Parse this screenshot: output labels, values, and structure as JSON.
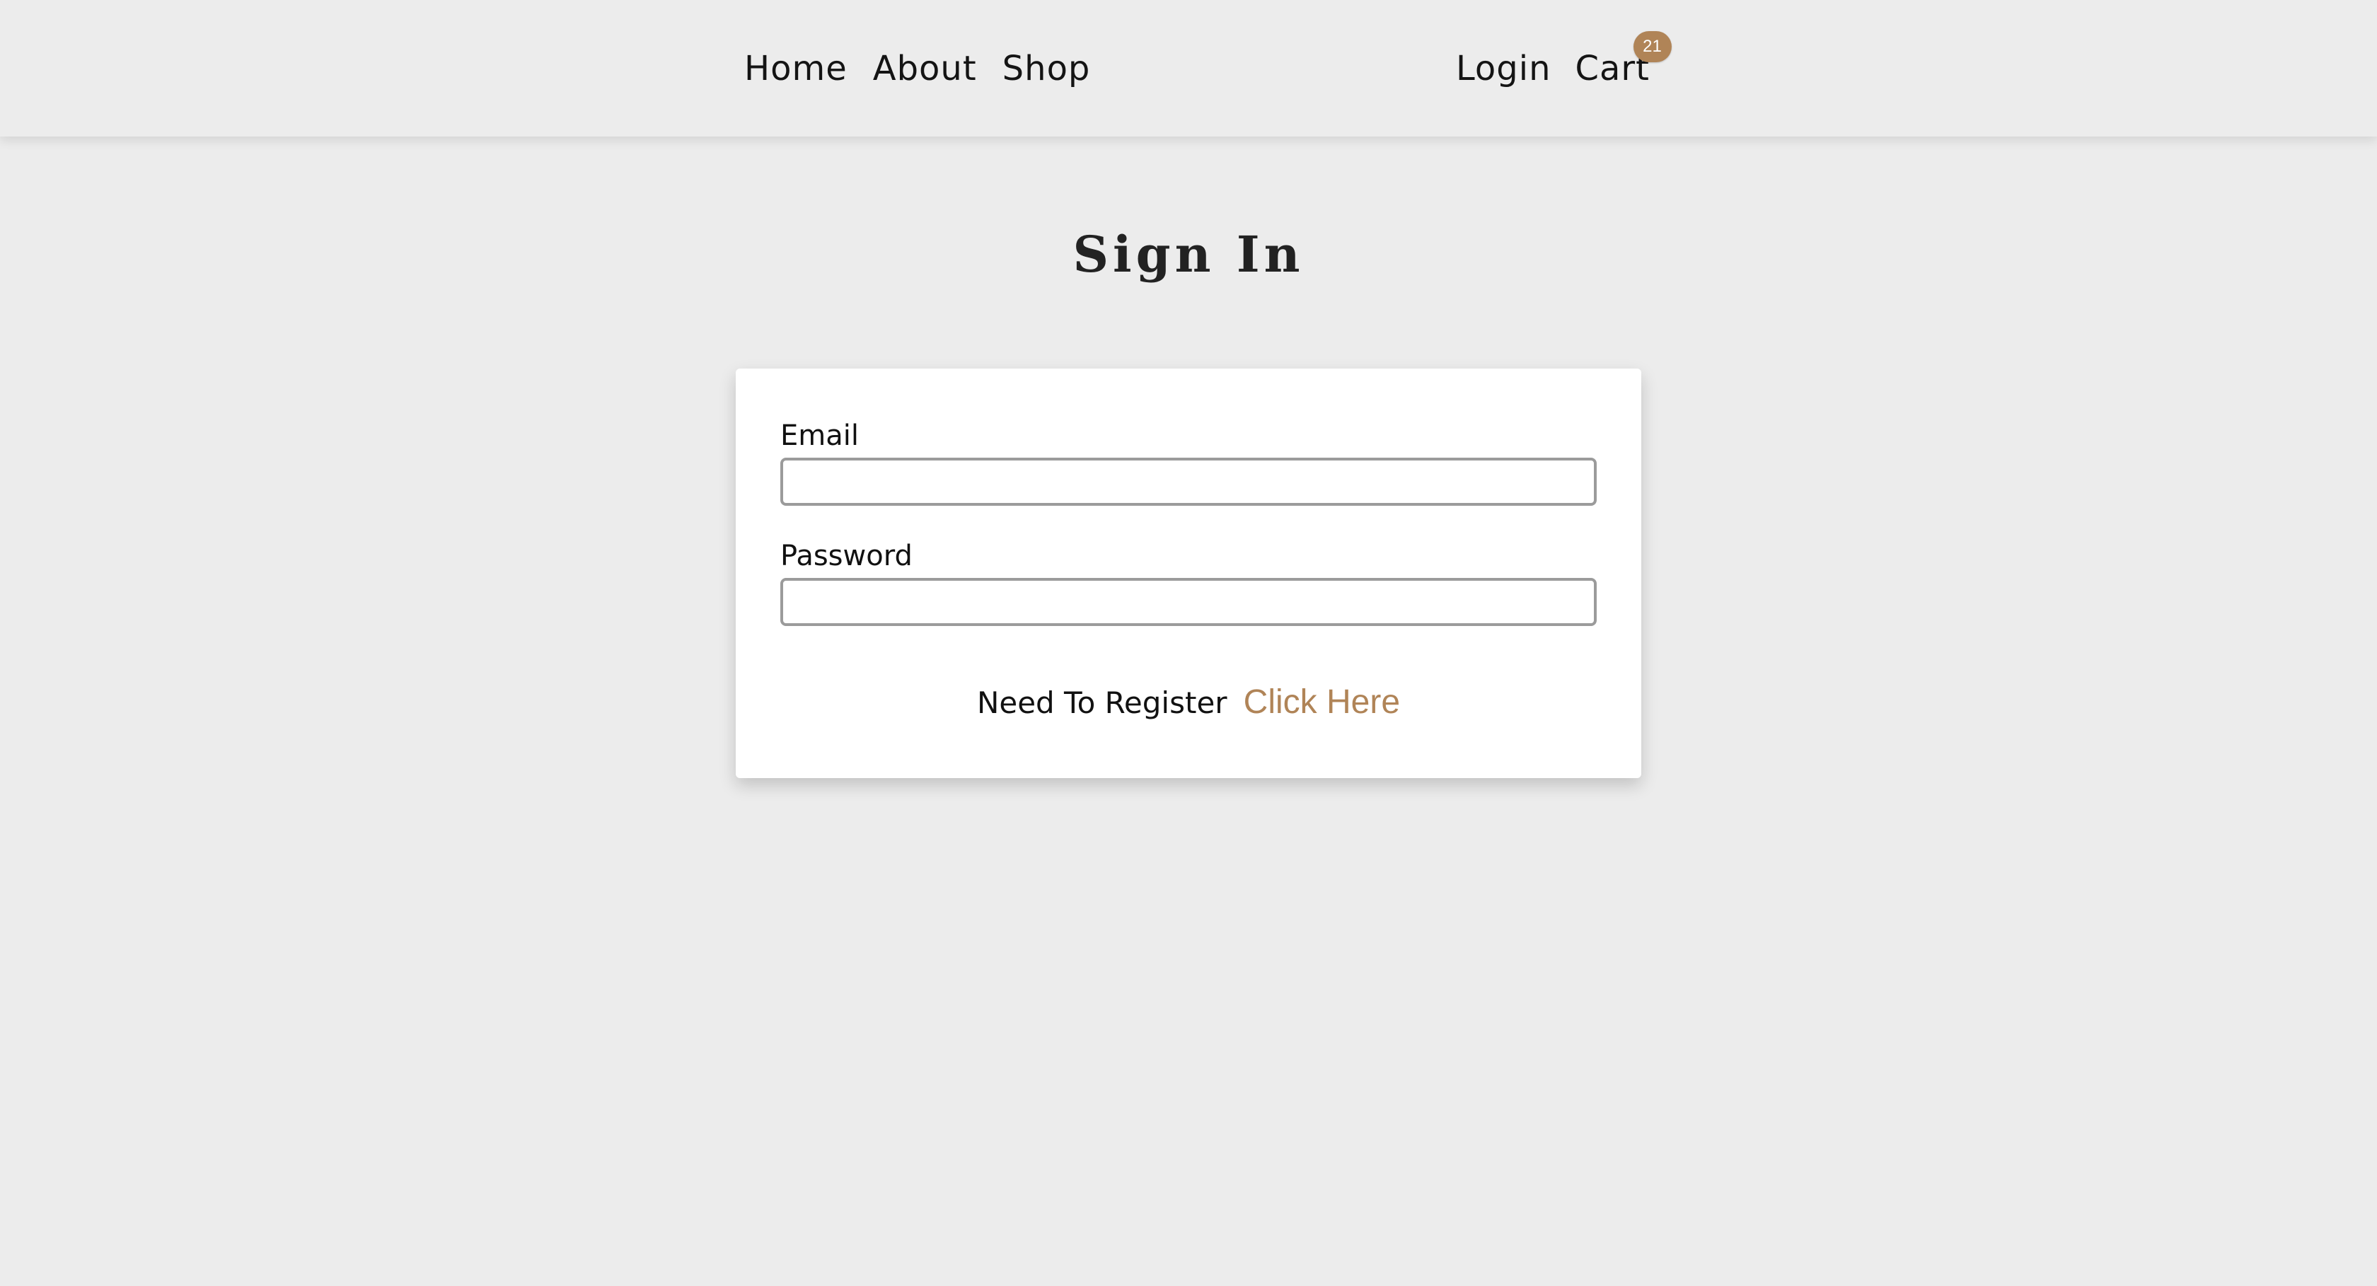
{
  "nav": {
    "left_links": [
      {
        "label": "Home"
      },
      {
        "label": "About"
      },
      {
        "label": "Shop"
      }
    ],
    "login_label": "Login",
    "cart_label": "Cart",
    "cart_count": "21"
  },
  "page": {
    "title": "Sign In"
  },
  "form": {
    "email_label": "Email",
    "email_value": "",
    "password_label": "Password",
    "password_value": "",
    "register_prompt": "Need To Register",
    "register_link": "Click Here"
  },
  "colors": {
    "background": "#ececec",
    "card_background": "#ffffff",
    "accent": "#b08457",
    "text": "#111111"
  }
}
